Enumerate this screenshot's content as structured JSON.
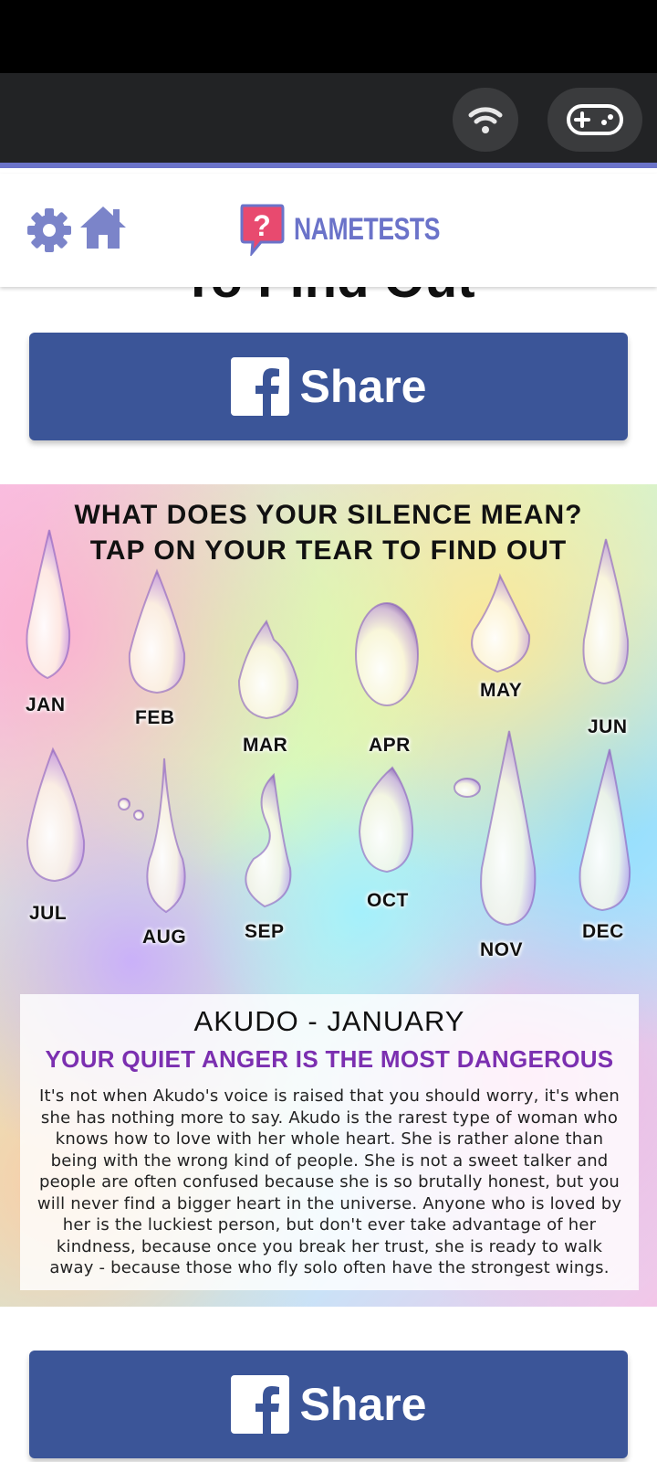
{
  "toolbar": {
    "wifi_icon": "wifi-icon",
    "game_icon": "gamepad-icon"
  },
  "appbar": {
    "settings_icon": "gear-icon",
    "home_icon": "home-icon",
    "logo_text": "NAMETESTS",
    "logo_icon": "question-bubble-icon",
    "accent_color": "#6b73c9"
  },
  "cut_title": "To Find Out",
  "share_top": {
    "label": "Share",
    "icon": "facebook-icon",
    "color": "#3b5598"
  },
  "quiz": {
    "title_line1": "WHAT DOES YOUR SILENCE MEAN?",
    "title_line2": "TAP ON YOUR TEAR TO FIND OUT",
    "months": [
      "JAN",
      "FEB",
      "MAR",
      "APR",
      "MAY",
      "JUN",
      "JUL",
      "AUG",
      "SEP",
      "OCT",
      "NOV",
      "DEC"
    ],
    "result": {
      "name": "AKUDO - JANUARY",
      "headline": "YOUR QUIET ANGER IS THE MOST DANGEROUS",
      "body": "It's not when Akudo's voice is raised that you should worry, it's when she has nothing more to say. Akudo is the rarest type of woman who knows how to love with her whole heart. She is rather alone than being with the wrong kind of people. She is not a sweet talker and people are often confused because she is so brutally honest, but you will never find a bigger heart in the universe. Anyone who is loved by her is the luckiest person, but don't ever take advantage of her kindness, because once you break her trust, she is ready to walk away - because those who fly solo often have the strongest wings.",
      "headline_color": "#7b2fb0"
    }
  },
  "share_bottom": {
    "label": "Share",
    "icon": "facebook-icon"
  }
}
